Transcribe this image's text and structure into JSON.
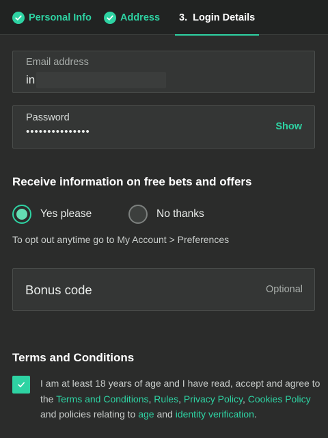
{
  "steps": [
    {
      "label": "Personal Info",
      "state": "done"
    },
    {
      "label": "Address",
      "state": "done"
    },
    {
      "label": "3.  Login Details",
      "state": "current"
    }
  ],
  "email": {
    "label": "Email address",
    "value": "in"
  },
  "password": {
    "label": "Password",
    "value": "•••••••••••••••",
    "toggle_label": "Show"
  },
  "offers": {
    "heading": "Receive information on free bets and offers",
    "options": [
      {
        "label": "Yes please",
        "selected": true
      },
      {
        "label": "No thanks",
        "selected": false
      }
    ],
    "note": "To opt out anytime go to My Account > Preferences"
  },
  "bonus": {
    "label": "Bonus code",
    "hint": "Optional"
  },
  "terms": {
    "heading": "Terms and Conditions",
    "checked": true,
    "text_intro": "I am at least 18 years of age and I have read, accept and agree to the ",
    "links": {
      "terms": "Terms and Conditions",
      "rules": "Rules",
      "privacy": "Privacy Policy",
      "cookies": "Cookies Policy",
      "age": "age",
      "identity": "identity verification"
    },
    "sep_comma": ", ",
    "text_and_policies": " and policies relating to ",
    "text_and": " and ",
    "text_end": "."
  },
  "colors": {
    "accent": "#2ed3a3",
    "background": "#2b2c2b",
    "header_background": "#212322",
    "field_background": "#343635"
  }
}
